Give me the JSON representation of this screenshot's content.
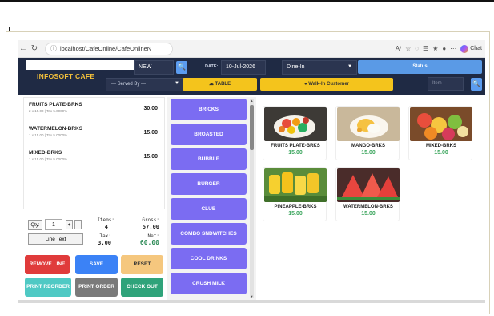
{
  "browser": {
    "url": "localhost/CafeOnline/CafeOnlineN",
    "chat_label": "Chat"
  },
  "header": {
    "order_type_value": "NEW",
    "date_label": "DATE:",
    "date_value": "10-Jul-2026",
    "dine_option": "Dine-In",
    "status_label": "Status",
    "logo": "INFOSOFT CAFE",
    "served_by": "--- Served By ---",
    "table_label": "TABLE",
    "customer_label": "Walk-In Customer",
    "item_search_placeholder": "Item"
  },
  "order": {
    "items": [
      {
        "name": "FRUITS PLATE-BRKS",
        "sub": "2 x 15.00 | Tax 5.0000%",
        "price": "30.00"
      },
      {
        "name": "WATERMELON-BRKS",
        "sub": "1 x 15.00 | Tax 5.0000%",
        "price": "15.00"
      },
      {
        "name": "MIXED-BRKS",
        "sub": "1 x 15.00 | Tax 5.0000%",
        "price": "15.00"
      }
    ],
    "qty_label": "Qty:",
    "qty_value": "1",
    "plus": "+",
    "minus": "-",
    "line_text": "Line Text",
    "items_label": "Items:",
    "items_value": "4",
    "gross_label": "Gross:",
    "gross_value": "57.00",
    "tax_label": "Tax:",
    "tax_value": "3.00",
    "net_label": "Net:",
    "net_value": "60.00"
  },
  "actions": {
    "remove_line": "REMOVE LINE",
    "save": "SAVE",
    "reset": "RESET",
    "print_reorder": "PRINT REORDER",
    "print_order": "PRINT ORDER",
    "check_out": "CHECK OUT"
  },
  "categories": [
    "BRICKS",
    "BROASTED",
    "BUBBLE",
    "BURGER",
    "CLUB",
    "COMBO SNDWITCHES",
    "COOL DRINKS",
    "CRUSH MILK"
  ],
  "products": [
    {
      "name": "FRUITS PLATE-BRKS",
      "price": "15.00"
    },
    {
      "name": "MANGO-BRKS",
      "price": "15.00"
    },
    {
      "name": "MIXED-BRKS",
      "price": "15.00"
    },
    {
      "name": "PINEAPPLE-BRKS",
      "price": "15.00"
    },
    {
      "name": "WATERMELON-BRKS",
      "price": "15.00"
    }
  ],
  "colors": {
    "header_bg": "#1f2a44",
    "accent_yellow": "#f4c41c",
    "category_purple": "#7b6cf2",
    "price_green": "#3aa55c",
    "remove": "#e03b3b",
    "save": "#3b82f6",
    "reset": "#f5c77e",
    "print_reorder": "#4fc9c4",
    "print_order": "#7a7a7a",
    "check_out": "#2fa37a"
  }
}
